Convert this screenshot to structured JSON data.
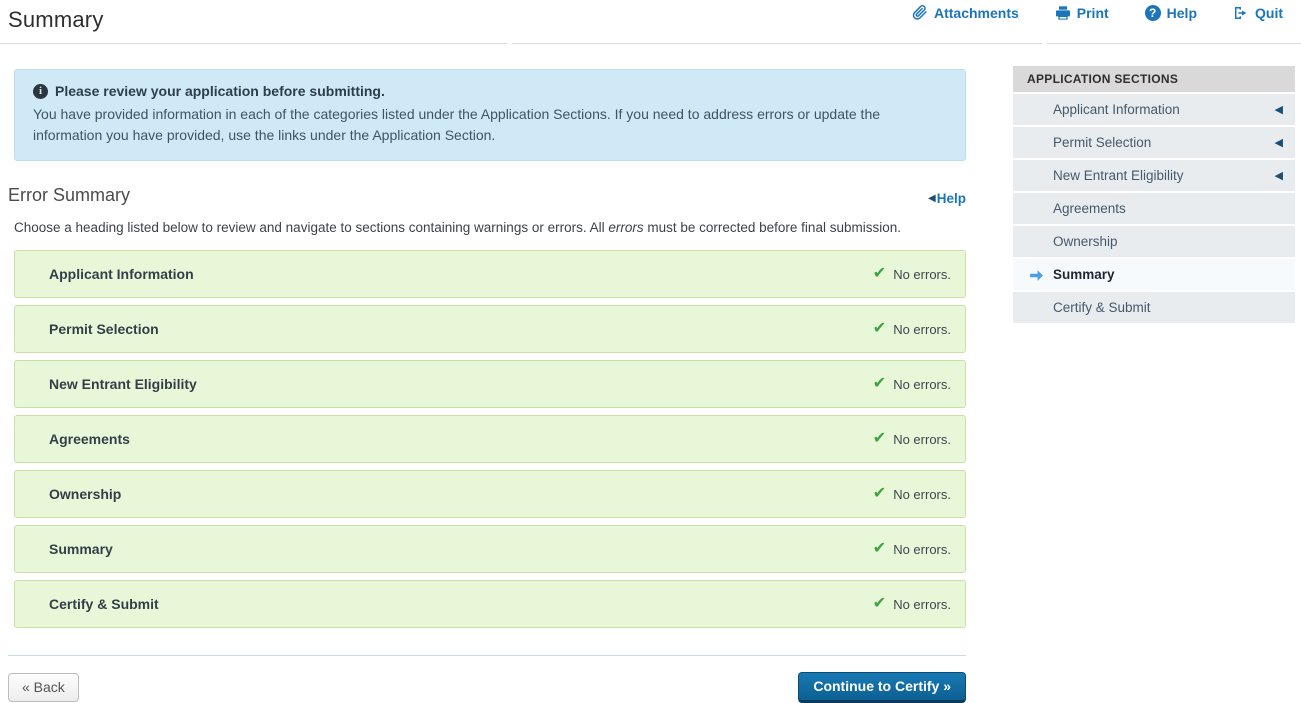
{
  "header": {
    "title": "Summary",
    "actions": [
      {
        "label": "Attachments",
        "icon": "paperclip-icon"
      },
      {
        "label": "Print",
        "icon": "printer-icon"
      },
      {
        "label": "Help",
        "icon": "question-circle-icon"
      },
      {
        "label": "Quit",
        "icon": "sign-out-icon"
      }
    ]
  },
  "notice": {
    "heading": "Please review your application before submitting.",
    "body": "You have provided information in each of the categories listed under the Application Sections. If you need to address errors or update the information you have provided, use the links under the Application Section."
  },
  "error_summary": {
    "title": "Error Summary",
    "help_label": "Help",
    "help_arrow": "◀",
    "instructions_prefix": "Choose a heading listed below to review and navigate to sections containing warnings or errors. All ",
    "instructions_italic": "errors",
    "instructions_suffix": " must be corrected before final submission.",
    "check_glyph": "✔",
    "rows": [
      {
        "label": "Applicant Information",
        "status": "No errors."
      },
      {
        "label": "Permit Selection",
        "status": "No errors."
      },
      {
        "label": "New Entrant Eligibility",
        "status": "No errors."
      },
      {
        "label": "Agreements",
        "status": "No errors."
      },
      {
        "label": "Ownership",
        "status": "No errors."
      },
      {
        "label": "Summary",
        "status": "No errors."
      },
      {
        "label": "Certify & Submit",
        "status": "No errors."
      }
    ]
  },
  "sidebar": {
    "title": "APPLICATION SECTIONS",
    "collapse_glyph": "◀",
    "items": [
      {
        "label": "Applicant Information",
        "collapsible": true,
        "active": false
      },
      {
        "label": "Permit Selection",
        "collapsible": true,
        "active": false
      },
      {
        "label": "New Entrant Eligibility",
        "collapsible": true,
        "active": false
      },
      {
        "label": "Agreements",
        "collapsible": false,
        "active": false
      },
      {
        "label": "Ownership",
        "collapsible": false,
        "active": false
      },
      {
        "label": "Summary",
        "collapsible": false,
        "active": true
      },
      {
        "label": "Certify & Submit",
        "collapsible": false,
        "active": false
      }
    ]
  },
  "footer": {
    "back_label": "« Back",
    "continue_label": "Continue to Certify »"
  },
  "colors": {
    "link_blue": "#1b75bb",
    "notice_bg": "#cfe9f7",
    "bar_bg": "#e9f7d9",
    "bar_border": "#c9e0a8",
    "check_green": "#3fa33f",
    "continue_button_bg": "#0d6092",
    "sidebar_header_bg": "#d9d9d9",
    "sidebar_item_bg": "#e9ecee",
    "active_arrow_blue": "#4aa0e8"
  }
}
